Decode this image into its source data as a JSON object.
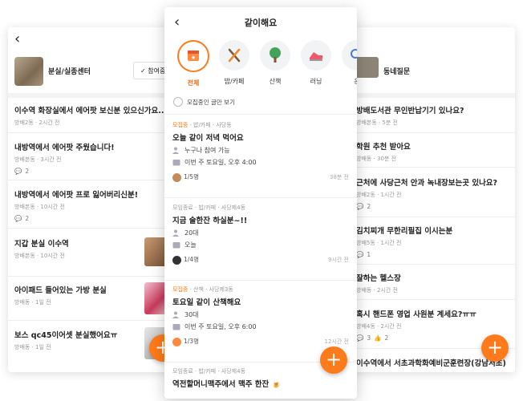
{
  "left": {
    "shop_name": "분실/실종센터",
    "follow_label": "참여중",
    "items": [
      {
        "title": "이수역 화장실에서 에어팟 보신분 있으신가요...?",
        "meta": "방배2동 · 2시간 전"
      },
      {
        "title": "내방역에서 에어팟 주웠습니다!",
        "meta": "방배본동 · 3시간 전",
        "comments": "2"
      },
      {
        "title": "내방역에서 에어팟 프로 잃어버리신분!",
        "meta": "방배본동 · 10시간 전",
        "comments": "2"
      },
      {
        "title": "지갑 분실 이수역",
        "meta": "방배본동 · 10시간 전"
      },
      {
        "title": "아이패드 들어있는 가방 분실",
        "meta": "방배동 · 1일 전"
      },
      {
        "title": "보스 qc45이어셋 분실했어요ㅠ",
        "meta": "방배동 · 1일 전"
      }
    ]
  },
  "center": {
    "title": "같이해요",
    "categories": [
      {
        "label": "전체",
        "icon": "calendar-star-icon"
      },
      {
        "label": "밥/카페",
        "icon": "utensils-icon"
      },
      {
        "label": "산책",
        "icon": "tree-icon"
      },
      {
        "label": "러닝",
        "icon": "sneaker-icon"
      },
      {
        "label": "운",
        "icon": "search-icon"
      }
    ],
    "filter_label": "모집중인 글만 보기",
    "posts": [
      {
        "status": "모집중",
        "status_open": true,
        "tags": " · 밥/카페 · 사당동",
        "title": "오늘 같이 저녁 먹어요",
        "line1": "누구나 참여 가능",
        "line2": "이번 주 토요일, 오후 4:00",
        "count": "1/5명",
        "time": "38분 전"
      },
      {
        "status": "모임종료",
        "status_open": false,
        "tags": " · 밥/카페 · 사당제4동",
        "title": "지금 술한잔 하실분~!!",
        "line1": "20대",
        "line2": "오늘",
        "count": "1/4명",
        "time": "9시간 전"
      },
      {
        "status": "모집중",
        "status_open": true,
        "tags": " · 산책 · 사당제3동",
        "title": "토요일 같이 산책해요",
        "line1": "30대",
        "line2": "이번 주 토요일, 오후 6:00",
        "count": "1/3명",
        "time": "12시간 전"
      },
      {
        "status": "모임종료",
        "status_open": false,
        "tags": " · 밥/카페 · 사당제4동",
        "title": "역전할머니맥주에서 맥주 한잔 🍺"
      }
    ]
  },
  "right": {
    "shop_name": "동네질문",
    "items": [
      {
        "title": "방배도서관 무인반납기기 있나요?",
        "meta": "방배본동 · 5분 전"
      },
      {
        "title": "학원 추천 받아요",
        "meta": "방배동 · 30분 전"
      },
      {
        "title": "근처에 사당근처 안과 녹내장보는곳 있나요?",
        "meta": "방배2동 · 1시간 전",
        "comments": "2"
      },
      {
        "title": "김치찌개 무한리필집 이시는분",
        "meta": "방배5동 · 1시간 전",
        "comments": "1"
      },
      {
        "title": "잘하는 헬스장",
        "meta": "방배동 · 2시간 전"
      },
      {
        "title": "혹시 핸드폰 영업 사원분 계세요?ㅠㅠ",
        "meta": "방배4동 · 2시간 전",
        "comments": "3",
        "likes": "2"
      },
      {
        "title": "이수역에서 서초과학화예비군훈련장(강남서초)",
        "meta": ""
      }
    ]
  },
  "colors": {
    "accent": "#ff7a1a"
  }
}
